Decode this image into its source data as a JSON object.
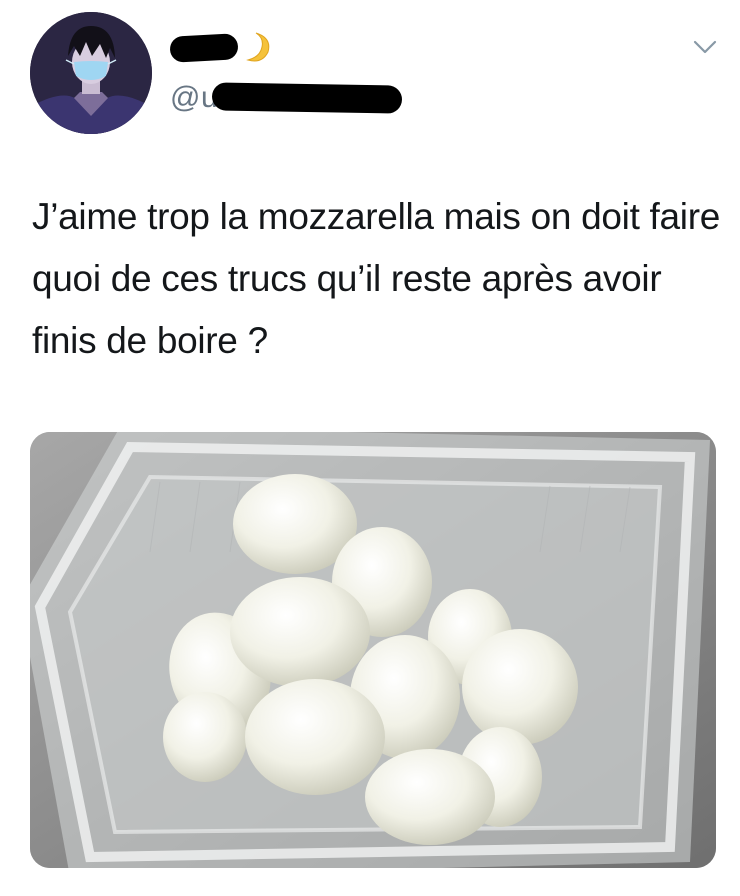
{
  "tweet": {
    "author": {
      "handle_prefix": "@u",
      "name_emoji_icon": "crescent-moon-icon"
    },
    "text": "J’aime trop la mozzarella mais on doit faire quoi de ces trucs qu’il reste après avoir finis de boire ?",
    "menu_icon": "chevron-down-icon",
    "media": {
      "subject": "mozzarella-balls-in-plastic-tray"
    }
  },
  "colors": {
    "text": "#14171a",
    "secondary_text": "#687684",
    "chevron": "#8899a6",
    "moon": "#f5c23b"
  }
}
